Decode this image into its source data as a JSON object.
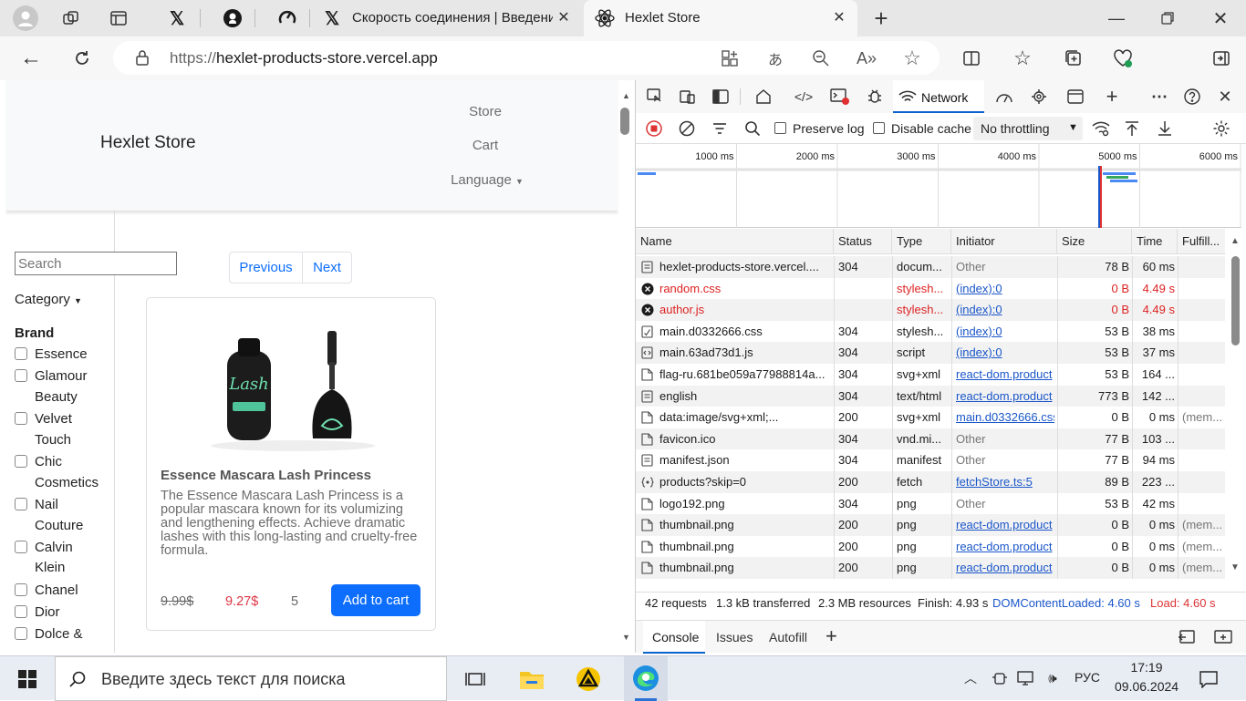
{
  "browser": {
    "tabs": [
      {
        "label": "",
        "icon": "profile-icon"
      },
      {
        "label": "",
        "icon": "workspaces-icon"
      },
      {
        "label": "",
        "icon": "tab-actions-icon"
      },
      {
        "label": "",
        "icon": "x-icon"
      },
      {
        "label": "",
        "icon": "github-icon"
      },
      {
        "label": "",
        "icon": "speedtest-icon"
      },
      {
        "label": "Скорость соединения | Введени",
        "icon": "x-icon"
      },
      {
        "label": "Hexlet Store",
        "icon": "react-icon"
      }
    ],
    "url_prefix": "https://",
    "url_host": "hexlet-products-store.vercel.app"
  },
  "site": {
    "brand": "Hexlet Store",
    "nav": {
      "store": "Store",
      "cart": "Cart",
      "language": "Language"
    },
    "search_placeholder": "Search",
    "category": "Category",
    "brand_heading": "Brand",
    "brands": [
      "Essence",
      "Glamour",
      "Beauty",
      "Velvet",
      "Touch",
      "Chic",
      "Cosmetics",
      "Nail",
      "Couture",
      "Calvin",
      "Klein",
      "Chanel",
      "Dior",
      "Dolce &"
    ],
    "pagination": {
      "prev": "Previous",
      "next": "Next"
    },
    "product": {
      "title": "Essence Mascara Lash Princess",
      "description": "The Essence Mascara Lash Princess is a popular mascara known for its volumizing and lengthening effects. Achieve dramatic lashes with this long-lasting and cruelty-free formula.",
      "old_price": "9.99$",
      "price": "9.27$",
      "rating": "5",
      "add_to_cart": "Add to cart"
    }
  },
  "devtools": {
    "active_tab": "Network",
    "preserve_log": "Preserve log",
    "disable_cache": "Disable cache",
    "throttling": "No throttling",
    "timeline_ticks": [
      "1000 ms",
      "2000 ms",
      "3000 ms",
      "4000 ms",
      "5000 ms",
      "6000 ms"
    ],
    "columns": [
      "Name",
      "Status",
      "Type",
      "Initiator",
      "Size",
      "Time",
      "Fulfill..."
    ],
    "rows": [
      {
        "name": "hexlet-products-store.vercel....",
        "status": "304",
        "type": "docum...",
        "initiator": "Other",
        "size": "78 B",
        "time": "60 ms",
        "fulfill": "",
        "icon": "document-icon"
      },
      {
        "name": "random.css",
        "status": "",
        "type": "stylesh...",
        "initiator": "(index):0",
        "size": "0 B",
        "time": "4.49 s",
        "fulfill": "",
        "icon": "error-icon"
      },
      {
        "name": "author.js",
        "status": "",
        "type": "stylesh...",
        "initiator": "(index):0",
        "size": "0 B",
        "time": "4.49 s",
        "fulfill": "",
        "icon": "error-icon"
      },
      {
        "name": "main.d0332666.css",
        "status": "304",
        "type": "stylesh...",
        "initiator": "(index):0",
        "size": "53 B",
        "time": "38 ms",
        "fulfill": "",
        "icon": "css-icon"
      },
      {
        "name": "main.63ad73d1.js",
        "status": "304",
        "type": "script",
        "initiator": "(index):0",
        "size": "53 B",
        "time": "37 ms",
        "fulfill": "",
        "icon": "script-icon"
      },
      {
        "name": "flag-ru.681be059a77988814a...",
        "status": "304",
        "type": "svg+xml",
        "initiator": "react-dom.product",
        "size": "53 B",
        "time": "164 ...",
        "fulfill": "",
        "icon": "image-icon"
      },
      {
        "name": "english",
        "status": "304",
        "type": "text/html",
        "initiator": "react-dom.product",
        "size": "773 B",
        "time": "142 ...",
        "fulfill": "",
        "icon": "document-icon"
      },
      {
        "name": "data:image/svg+xml;...",
        "status": "200",
        "type": "svg+xml",
        "initiator": "main.d0332666.css",
        "size": "0 B",
        "time": "0 ms",
        "fulfill": "(mem...",
        "icon": "image-icon"
      },
      {
        "name": "favicon.ico",
        "status": "304",
        "type": "vnd.mi...",
        "initiator": "Other",
        "size": "77 B",
        "time": "103 ...",
        "fulfill": "",
        "icon": "image-icon"
      },
      {
        "name": "manifest.json",
        "status": "304",
        "type": "manifest",
        "initiator": "Other",
        "size": "77 B",
        "time": "94 ms",
        "fulfill": "",
        "icon": "document-icon"
      },
      {
        "name": "products?skip=0",
        "status": "200",
        "type": "fetch",
        "initiator": "fetchStore.ts:5",
        "size": "89 B",
        "time": "223 ...",
        "fulfill": "",
        "icon": "fetch-icon"
      },
      {
        "name": "logo192.png",
        "status": "304",
        "type": "png",
        "initiator": "Other",
        "size": "53 B",
        "time": "42 ms",
        "fulfill": "",
        "icon": "image-icon"
      },
      {
        "name": "thumbnail.png",
        "status": "200",
        "type": "png",
        "initiator": "react-dom.product",
        "size": "0 B",
        "time": "0 ms",
        "fulfill": "(mem...",
        "icon": "image-icon"
      },
      {
        "name": "thumbnail.png",
        "status": "200",
        "type": "png",
        "initiator": "react-dom.product",
        "size": "0 B",
        "time": "0 ms",
        "fulfill": "(mem...",
        "icon": "image-icon"
      },
      {
        "name": "thumbnail.png",
        "status": "200",
        "type": "png",
        "initiator": "react-dom.product",
        "size": "0 B",
        "time": "0 ms",
        "fulfill": "(mem...",
        "icon": "image-icon"
      }
    ],
    "status": {
      "requests": "42 requests",
      "transferred": "1.3 kB transferred",
      "resources": "2.3 MB resources",
      "finish": "Finish: 4.93 s",
      "dcl": "DOMContentLoaded: 4.60 s",
      "load": "Load: 4.60 s"
    },
    "drawer_tabs": [
      "Console",
      "Issues",
      "Autofill"
    ]
  },
  "taskbar": {
    "search_placeholder": "Введите здесь текст для поиска",
    "lang": "РУС",
    "time": "17:19",
    "date": "09.06.2024"
  },
  "colors": {
    "accent": "#0d6efd",
    "error": "#d22",
    "link": "#1a56c9",
    "load": "#d33"
  }
}
